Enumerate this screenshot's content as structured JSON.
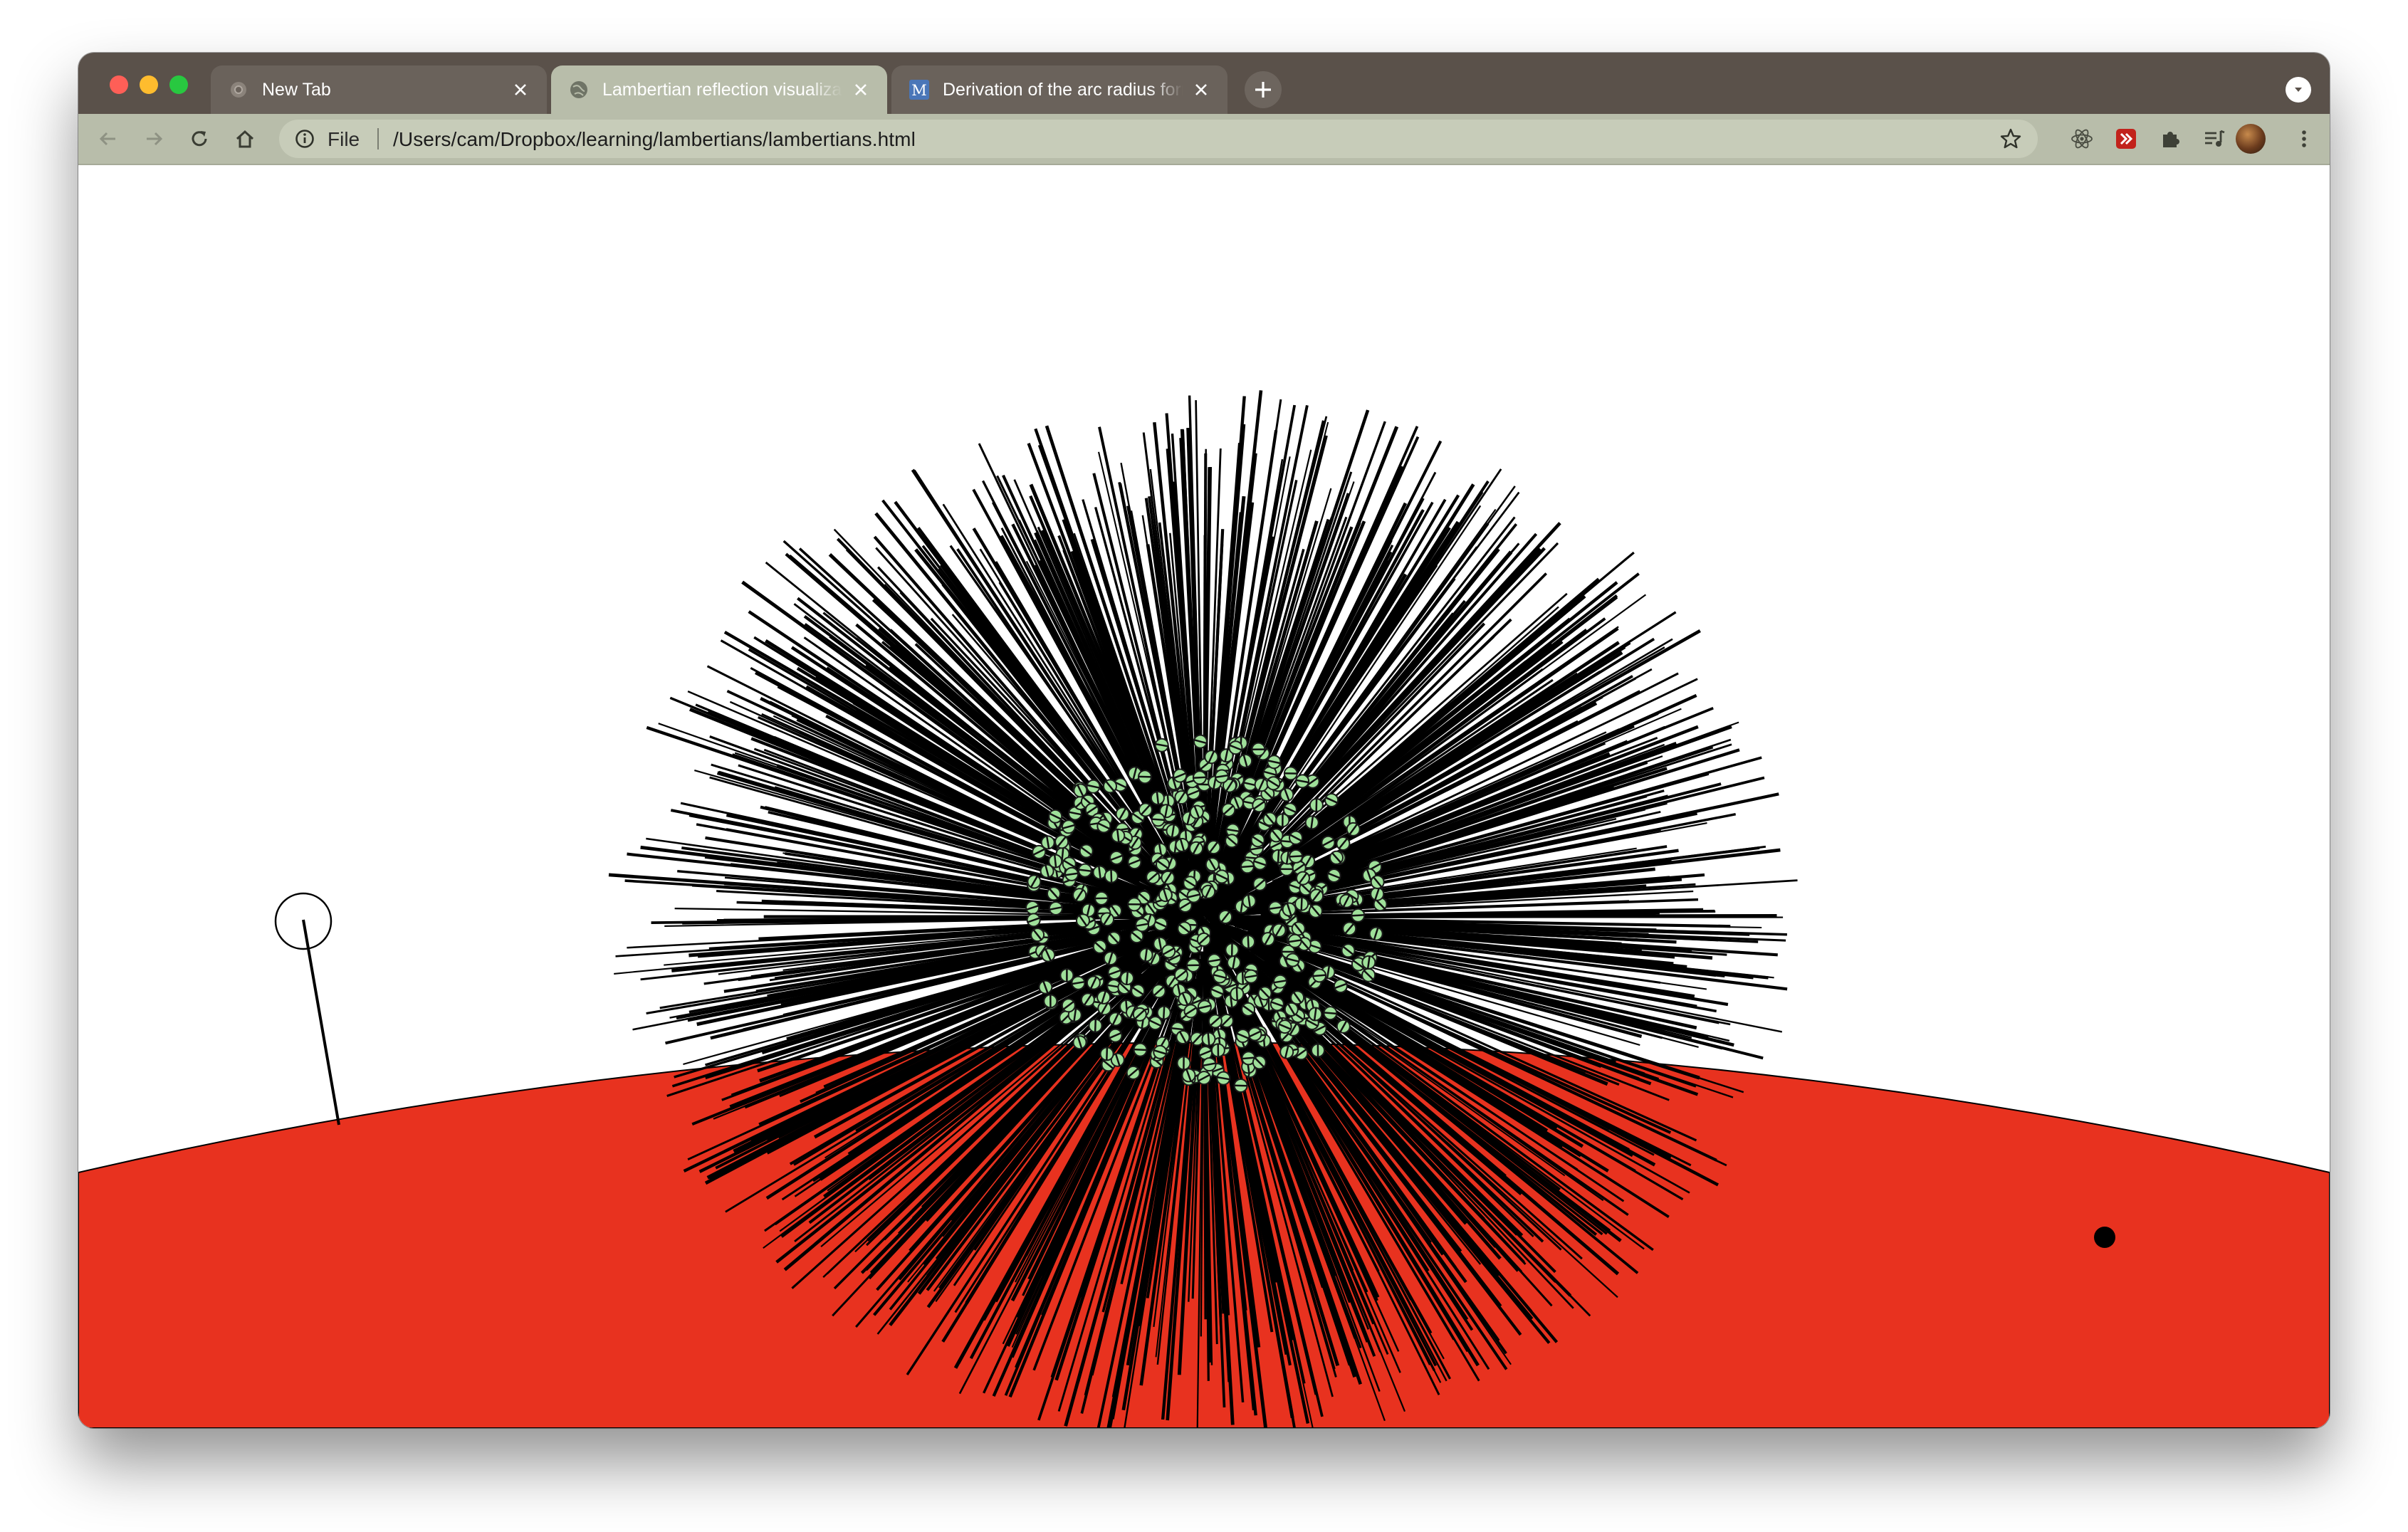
{
  "tabs": [
    {
      "title": "New Tab",
      "favicon": "chrome-icon",
      "active": false
    },
    {
      "title": "Lambertian reflection visualization",
      "favicon": "globe-icon",
      "active": true
    },
    {
      "title": "Derivation of the arc radius formula",
      "favicon": "M",
      "active": false
    }
  ],
  "toolbar": {
    "scheme_label": "File",
    "url": "/Users/cam/Dropbox/learning/lambertians/lambertians.html",
    "extensions": [
      "react-devtools-icon",
      "red-extension-icon",
      "puzzle-icon",
      "media-queue-icon"
    ]
  },
  "scene": {
    "ground_color": "#e8321f",
    "sample_dot_color": "#9fe09a",
    "ray_color": "#000000"
  }
}
